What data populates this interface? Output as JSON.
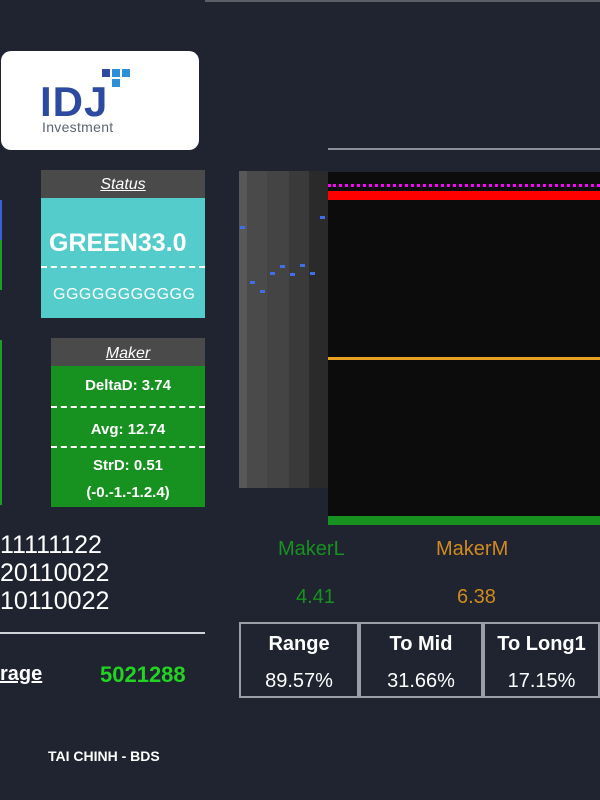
{
  "logo": {
    "mark": "IDJ",
    "text": "Investment",
    "colors": {
      "primary": "#2b4aa0",
      "accent": "#2e8fd9"
    }
  },
  "status": {
    "title": "Status",
    "value": "GREEN33.0",
    "sub": "GGGGGGGGGGG"
  },
  "maker": {
    "title": "Maker",
    "delta": "DeltaD: 3.74",
    "avg": "Avg: 12.74",
    "strd": "StrD: 0.51",
    "range": "(-0.-1.-1.2.4)"
  },
  "labels": {
    "makerL": "MakerL",
    "makerM": "MakerM",
    "makerL_value": "4.41",
    "makerM_value": "6.38"
  },
  "codes": [
    "11111122",
    "20110022",
    "10110022"
  ],
  "stats": [
    {
      "label": "Range",
      "value": "89.57%"
    },
    {
      "label": "To Mid",
      "value": "31.66%"
    },
    {
      "label": "To Long1",
      "value": "17.15%"
    }
  ],
  "average": {
    "label": "rage",
    "value": "5021288"
  },
  "sector": "TAI CHINH - BDS",
  "colors": {
    "background": "#1f2430",
    "status": "#55cccc",
    "maker": "#17911f",
    "makerL": "#17911f",
    "makerM": "#d08a1e",
    "red_line": "#ff0000",
    "magenta_dots": "#ff00ff",
    "orange_line": "#e8a020",
    "green_bar": "#17911f"
  }
}
